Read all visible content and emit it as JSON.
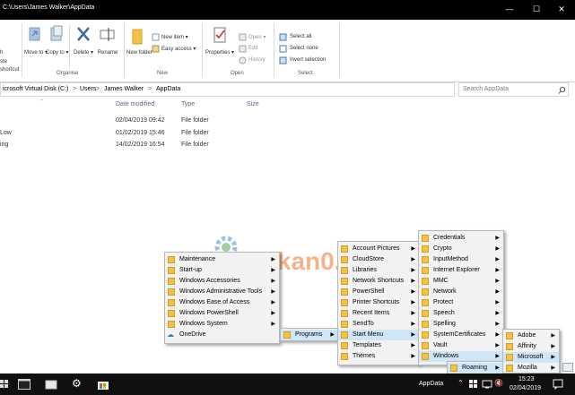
{
  "window": {
    "title": "C:\\Users\\James Walker\\AppData",
    "btn_min": "—",
    "btn_max": "☐",
    "btn_close": "✕"
  },
  "ribbon": {
    "clipboard_partial": [
      "h",
      "ste",
      "shortcut"
    ],
    "move_to": "Move to ▾",
    "copy_to": "Copy to ▾",
    "delete": "Delete ▾",
    "rename": "Rename",
    "new_folder": "New folder",
    "new_item": "New item ▾",
    "easy_access": "Easy access ▾",
    "properties": "Properties ▾",
    "open": "Open ▾",
    "edit": "Edit",
    "history": "History",
    "select_all": "Select all",
    "select_none": "Select none",
    "invert_selection": "Invert selection",
    "group_organise": "Organise",
    "group_new": "New",
    "group_open": "Open",
    "group_select": "Select"
  },
  "address": {
    "crumbs": [
      "icrosoft Virtual Disk (C:)",
      "Users",
      "James Walker",
      "AppData"
    ],
    "sep": ">",
    "search_placeholder": "Search AppData"
  },
  "columns": [
    "Date modified",
    "Type",
    "Size"
  ],
  "rows": [
    {
      "name": "",
      "date": "02/04/2019 09:42",
      "type": "File folder"
    },
    {
      "name": "Low",
      "date": "01/02/2019 15:46",
      "type": "File folder"
    },
    {
      "name": "ing",
      "date": "14/02/2019 16:54",
      "type": "File folder"
    }
  ],
  "menu_start": [
    "Maintenance",
    "Start-up",
    "Windows Accessories",
    "Windows Administrative Tools",
    "Windows Ease of Access",
    "Windows PowerShell",
    "Windows System",
    "OneDrive"
  ],
  "menu_programs": "Programs",
  "menu_startmenu": [
    "Account Pictures",
    "CloudStore",
    "Libraries",
    "Network Shortcuts",
    "PowerShell",
    "Printer Shortcuts",
    "Recent Items",
    "SendTo",
    "Start Menu",
    "Templates",
    "Themes"
  ],
  "menu_microsoft": [
    "Credentials",
    "Crypto",
    "InputMethod",
    "Internet Explorer",
    "MMC",
    "Network",
    "Protect",
    "Speech",
    "Spelling",
    "SystemCertificates",
    "Vault",
    "Windows"
  ],
  "menu_roaming": "Roaming",
  "menu_appdata": [
    "Adobe",
    "Affinity",
    "Microsoft",
    "Mozilla"
  ],
  "watermark": "Mekan0.com",
  "taskbar": {
    "toolbar_label": "AppData",
    "time": "15:23",
    "date": "02/04/2019"
  },
  "colors": {
    "selection": "#cfe6f7",
    "arrow": "#e0201a",
    "folder": "#f0c24a"
  }
}
